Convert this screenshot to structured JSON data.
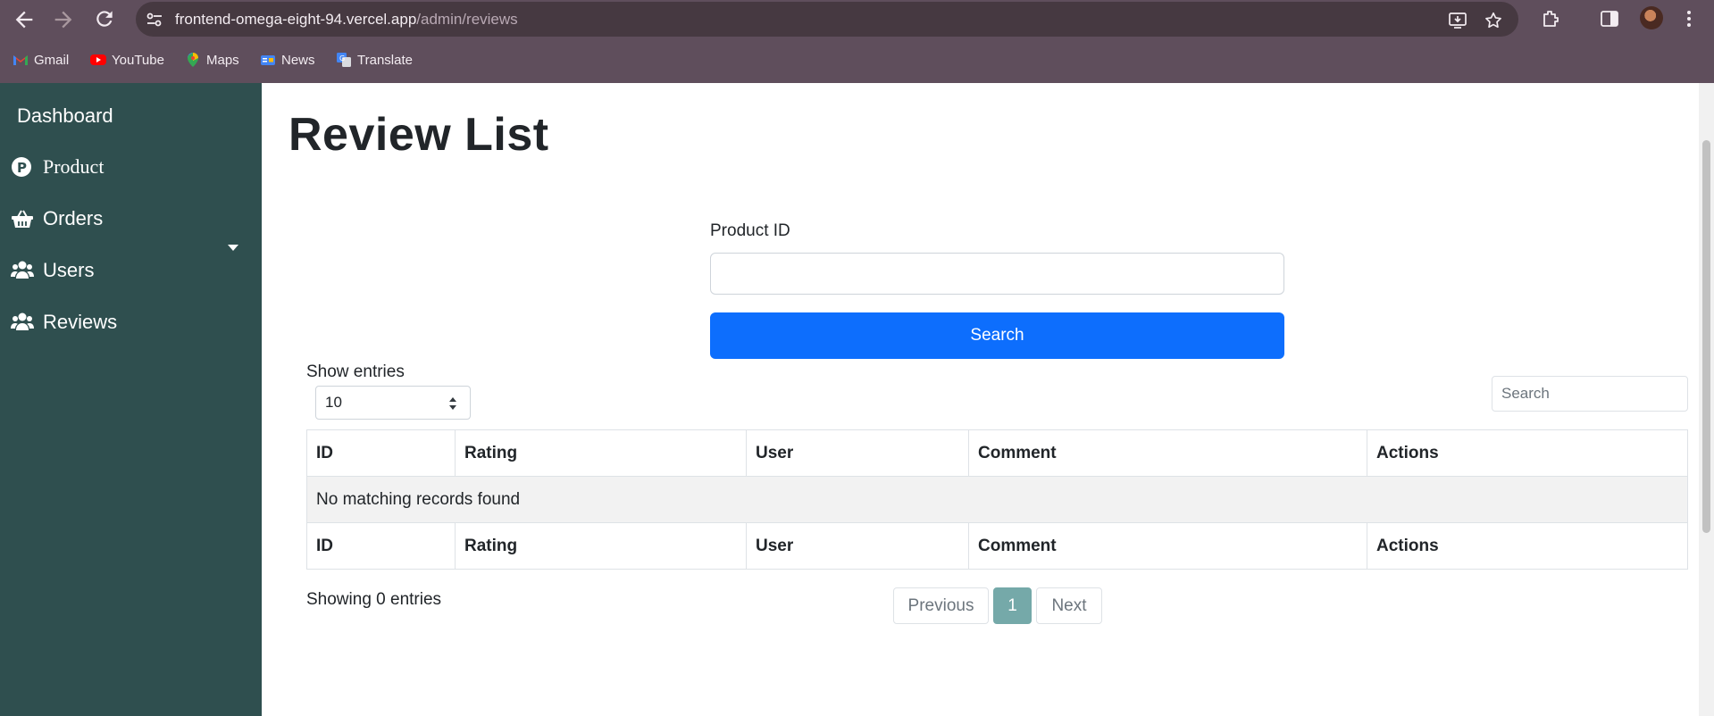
{
  "browser": {
    "url_host": "frontend-omega-eight-94.vercel.app",
    "url_path": "/admin/reviews",
    "icons": [
      "back-icon",
      "forward-icon",
      "reload-icon",
      "site-info-icon",
      "install-icon",
      "bookmark-star-icon",
      "extensions-icon",
      "side-panel-icon",
      "profile-avatar",
      "menu-icon"
    ],
    "bookmarks": [
      {
        "label": "Gmail",
        "icon": "gmail-icon"
      },
      {
        "label": "YouTube",
        "icon": "youtube-icon"
      },
      {
        "label": "Maps",
        "icon": "maps-icon"
      },
      {
        "label": "News",
        "icon": "news-icon"
      },
      {
        "label": "Translate",
        "icon": "translate-icon"
      }
    ]
  },
  "sidebar": {
    "items": [
      {
        "label": "Dashboard",
        "icon": ""
      },
      {
        "label": "Product",
        "icon": "product-p-icon"
      },
      {
        "label": "Orders",
        "icon": "basket-icon"
      },
      {
        "label": "Users",
        "icon": "users-icon"
      },
      {
        "label": "Reviews",
        "icon": "users-icon"
      }
    ],
    "background": "#2f4f4f"
  },
  "main": {
    "title": "Review List",
    "product_id_label": "Product ID",
    "product_id_value": "",
    "search_button": "Search",
    "show_entries_label": "Show entries",
    "entries_selected": "10",
    "table_search_placeholder": "Search",
    "columns": [
      "ID",
      "Rating",
      "User",
      "Comment",
      "Actions"
    ],
    "empty_message": "No matching records found",
    "showing_text": "Showing 0 entries",
    "pagination": {
      "previous": "Previous",
      "current": "1",
      "next": "Next"
    },
    "accent": "#0d6efd",
    "page_active_color": "#75a9a9"
  }
}
